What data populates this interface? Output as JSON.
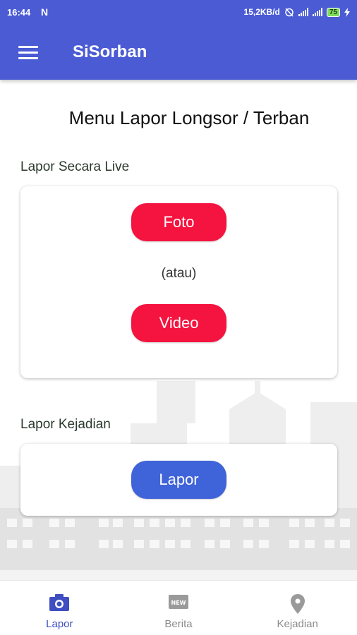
{
  "status": {
    "time": "16:44",
    "notif": "N",
    "net_speed": "15,2KB/d",
    "battery": "75"
  },
  "app": {
    "title": "SiSorban"
  },
  "page": {
    "title": "Menu Lapor Longsor / Terban"
  },
  "live_section": {
    "label": "Lapor Secara Live",
    "photo_button": "Foto",
    "or_text": "(atau)",
    "video_button": "Video"
  },
  "event_section": {
    "label": "Lapor Kejadian",
    "report_button": "Lapor"
  },
  "bottom_nav": {
    "items": [
      {
        "label": "Lapor",
        "icon": "camera-icon",
        "active": true
      },
      {
        "label": "Berita",
        "icon": "news-icon",
        "active": false
      },
      {
        "label": "Kejadian",
        "icon": "location-pin-icon",
        "active": false
      }
    ]
  },
  "colors": {
    "primary": "#4a5bd4",
    "danger_button": "#f5133f",
    "report_button": "#3f63d9",
    "nav_active": "#3f4ec0",
    "nav_inactive": "#8b8b8b"
  }
}
